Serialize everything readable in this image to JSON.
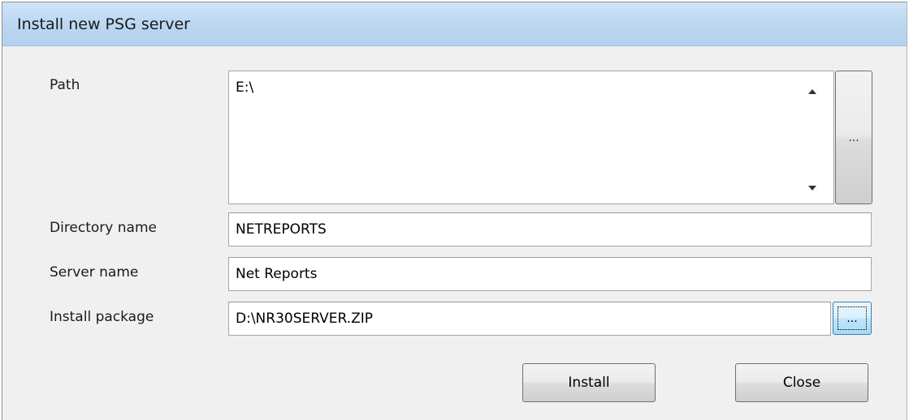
{
  "window": {
    "title": "Install new  PSG server"
  },
  "form": {
    "path": {
      "label": "Path",
      "value": "E:\\",
      "browse_label": "..."
    },
    "directory_name": {
      "label": "Directory name",
      "value": "NETREPORTS"
    },
    "server_name": {
      "label": "Server name",
      "value": "Net Reports"
    },
    "install_package": {
      "label": "Install package",
      "value": "D:\\NR30SERVER.ZIP",
      "browse_label": "..."
    }
  },
  "buttons": {
    "install": "Install",
    "close": "Close"
  },
  "colors": {
    "titlebar": "#bad6f1",
    "window_bg": "#f0f0f0",
    "focus_button": "#bee6fd"
  }
}
